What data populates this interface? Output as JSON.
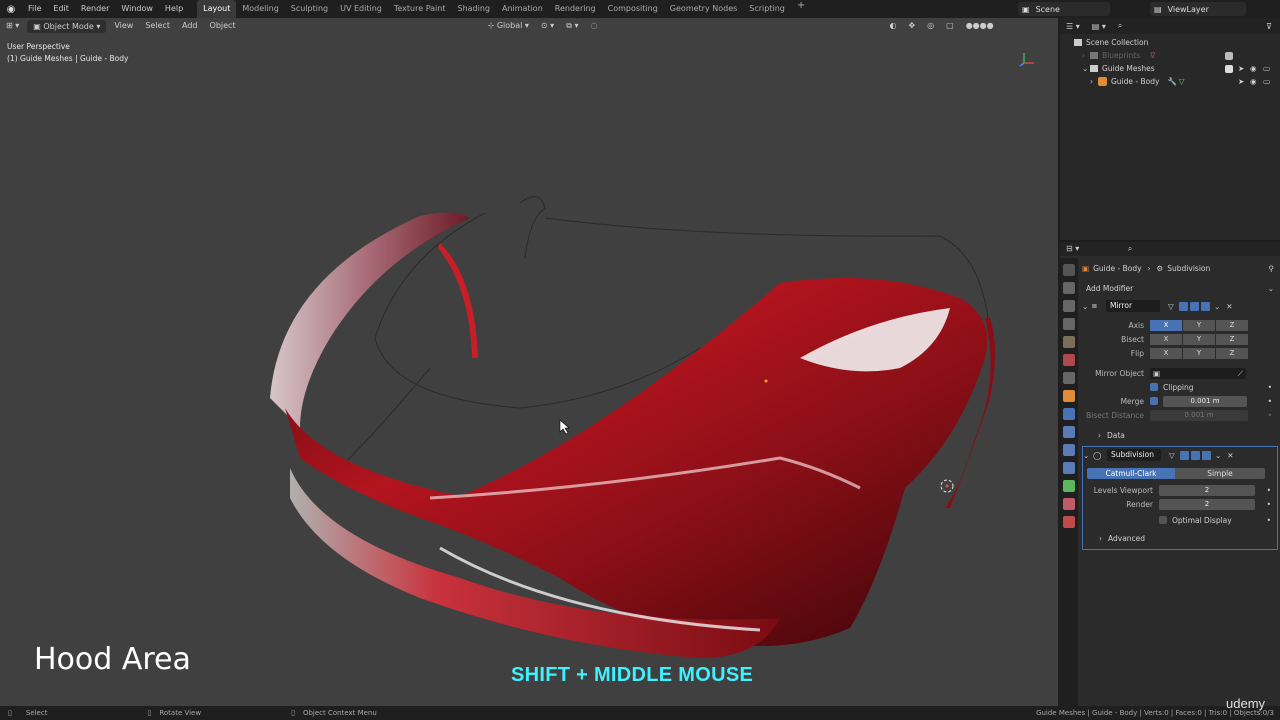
{
  "topbar": {
    "menus": [
      "File",
      "Edit",
      "Render",
      "Window",
      "Help"
    ],
    "workspaces": [
      "Layout",
      "Modeling",
      "Sculpting",
      "UV Editing",
      "Texture Paint",
      "Shading",
      "Animation",
      "Rendering",
      "Compositing",
      "Geometry Nodes",
      "Scripting"
    ],
    "active_workspace": "Layout",
    "scene": "Scene",
    "view_layer": "ViewLayer"
  },
  "viewport": {
    "mode": "Object Mode",
    "menus": [
      "View",
      "Select",
      "Add",
      "Object"
    ],
    "transform_orientation": "Global",
    "perspective_label": "User Perspective",
    "collection_label": "(1) Guide Meshes | Guide - Body"
  },
  "outliner": {
    "root": "Scene Collection",
    "items": [
      {
        "label": "Blueprints",
        "dim": true
      },
      {
        "label": "Guide Meshes",
        "dim": false
      },
      {
        "label": "Guide - Body",
        "dim": false
      }
    ]
  },
  "properties": {
    "breadcrumb_object": "Guide - Body",
    "breadcrumb_modifier": "Subdivision",
    "add_modifier": "Add Modifier",
    "mirror": {
      "name": "Mirror",
      "axis_label": "Axis",
      "bisect_label": "Bisect",
      "flip_label": "Flip",
      "xyz": [
        "X",
        "Y",
        "Z"
      ],
      "mirror_object_label": "Mirror Object",
      "clipping_label": "Clipping",
      "merge_label": "Merge",
      "merge_value": "0.001 m",
      "bisect_distance_label": "Bisect Distance",
      "bisect_distance_value": "0.001 m",
      "data_label": "Data"
    },
    "subdivision": {
      "name": "Subdivision",
      "mode_catmull": "Catmull-Clark",
      "mode_simple": "Simple",
      "levels_viewport_label": "Levels Viewport",
      "levels_viewport_value": "2",
      "render_label": "Render",
      "render_value": "2",
      "optimal_display_label": "Optimal Display",
      "advanced_label": "Advanced"
    }
  },
  "statusbar": {
    "select": "Select",
    "rotate": "Rotate View",
    "context": "Object Context Menu",
    "stats": "Guide Meshes | Guide - Body | Verts:0 | Faces:0 | Tris:0 | Objects:0/3"
  },
  "overlay": {
    "title": "Hood Area",
    "shortcut": "SHIFT + MIDDLE MOUSE",
    "watermark": "udemy"
  },
  "colors": {
    "accent": "#4772b3",
    "car_red": "#b3141e",
    "caption_cyan": "#3ff0ff"
  }
}
